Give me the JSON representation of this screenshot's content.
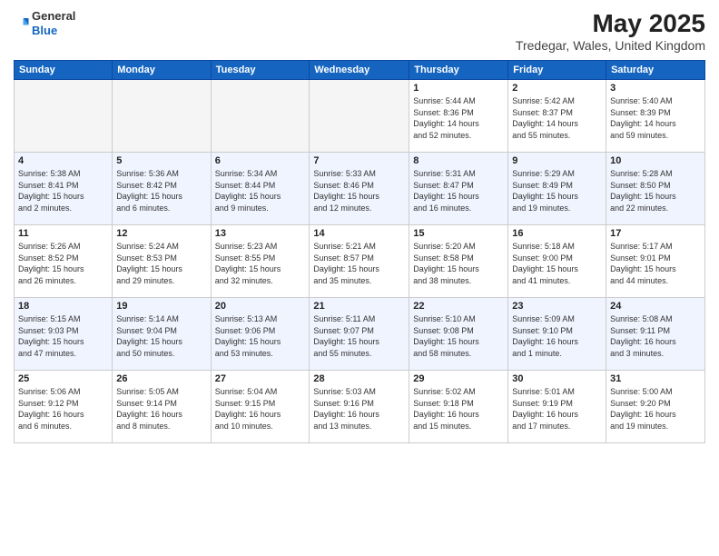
{
  "header": {
    "logo_line1": "General",
    "logo_line2": "Blue",
    "month": "May 2025",
    "location": "Tredegar, Wales, United Kingdom"
  },
  "days_of_week": [
    "Sunday",
    "Monday",
    "Tuesday",
    "Wednesday",
    "Thursday",
    "Friday",
    "Saturday"
  ],
  "weeks": [
    [
      {
        "day": "",
        "info": ""
      },
      {
        "day": "",
        "info": ""
      },
      {
        "day": "",
        "info": ""
      },
      {
        "day": "",
        "info": ""
      },
      {
        "day": "1",
        "info": "Sunrise: 5:44 AM\nSunset: 8:36 PM\nDaylight: 14 hours\nand 52 minutes."
      },
      {
        "day": "2",
        "info": "Sunrise: 5:42 AM\nSunset: 8:37 PM\nDaylight: 14 hours\nand 55 minutes."
      },
      {
        "day": "3",
        "info": "Sunrise: 5:40 AM\nSunset: 8:39 PM\nDaylight: 14 hours\nand 59 minutes."
      }
    ],
    [
      {
        "day": "4",
        "info": "Sunrise: 5:38 AM\nSunset: 8:41 PM\nDaylight: 15 hours\nand 2 minutes."
      },
      {
        "day": "5",
        "info": "Sunrise: 5:36 AM\nSunset: 8:42 PM\nDaylight: 15 hours\nand 6 minutes."
      },
      {
        "day": "6",
        "info": "Sunrise: 5:34 AM\nSunset: 8:44 PM\nDaylight: 15 hours\nand 9 minutes."
      },
      {
        "day": "7",
        "info": "Sunrise: 5:33 AM\nSunset: 8:46 PM\nDaylight: 15 hours\nand 12 minutes."
      },
      {
        "day": "8",
        "info": "Sunrise: 5:31 AM\nSunset: 8:47 PM\nDaylight: 15 hours\nand 16 minutes."
      },
      {
        "day": "9",
        "info": "Sunrise: 5:29 AM\nSunset: 8:49 PM\nDaylight: 15 hours\nand 19 minutes."
      },
      {
        "day": "10",
        "info": "Sunrise: 5:28 AM\nSunset: 8:50 PM\nDaylight: 15 hours\nand 22 minutes."
      }
    ],
    [
      {
        "day": "11",
        "info": "Sunrise: 5:26 AM\nSunset: 8:52 PM\nDaylight: 15 hours\nand 26 minutes."
      },
      {
        "day": "12",
        "info": "Sunrise: 5:24 AM\nSunset: 8:53 PM\nDaylight: 15 hours\nand 29 minutes."
      },
      {
        "day": "13",
        "info": "Sunrise: 5:23 AM\nSunset: 8:55 PM\nDaylight: 15 hours\nand 32 minutes."
      },
      {
        "day": "14",
        "info": "Sunrise: 5:21 AM\nSunset: 8:57 PM\nDaylight: 15 hours\nand 35 minutes."
      },
      {
        "day": "15",
        "info": "Sunrise: 5:20 AM\nSunset: 8:58 PM\nDaylight: 15 hours\nand 38 minutes."
      },
      {
        "day": "16",
        "info": "Sunrise: 5:18 AM\nSunset: 9:00 PM\nDaylight: 15 hours\nand 41 minutes."
      },
      {
        "day": "17",
        "info": "Sunrise: 5:17 AM\nSunset: 9:01 PM\nDaylight: 15 hours\nand 44 minutes."
      }
    ],
    [
      {
        "day": "18",
        "info": "Sunrise: 5:15 AM\nSunset: 9:03 PM\nDaylight: 15 hours\nand 47 minutes."
      },
      {
        "day": "19",
        "info": "Sunrise: 5:14 AM\nSunset: 9:04 PM\nDaylight: 15 hours\nand 50 minutes."
      },
      {
        "day": "20",
        "info": "Sunrise: 5:13 AM\nSunset: 9:06 PM\nDaylight: 15 hours\nand 53 minutes."
      },
      {
        "day": "21",
        "info": "Sunrise: 5:11 AM\nSunset: 9:07 PM\nDaylight: 15 hours\nand 55 minutes."
      },
      {
        "day": "22",
        "info": "Sunrise: 5:10 AM\nSunset: 9:08 PM\nDaylight: 15 hours\nand 58 minutes."
      },
      {
        "day": "23",
        "info": "Sunrise: 5:09 AM\nSunset: 9:10 PM\nDaylight: 16 hours\nand 1 minute."
      },
      {
        "day": "24",
        "info": "Sunrise: 5:08 AM\nSunset: 9:11 PM\nDaylight: 16 hours\nand 3 minutes."
      }
    ],
    [
      {
        "day": "25",
        "info": "Sunrise: 5:06 AM\nSunset: 9:12 PM\nDaylight: 16 hours\nand 6 minutes."
      },
      {
        "day": "26",
        "info": "Sunrise: 5:05 AM\nSunset: 9:14 PM\nDaylight: 16 hours\nand 8 minutes."
      },
      {
        "day": "27",
        "info": "Sunrise: 5:04 AM\nSunset: 9:15 PM\nDaylight: 16 hours\nand 10 minutes."
      },
      {
        "day": "28",
        "info": "Sunrise: 5:03 AM\nSunset: 9:16 PM\nDaylight: 16 hours\nand 13 minutes."
      },
      {
        "day": "29",
        "info": "Sunrise: 5:02 AM\nSunset: 9:18 PM\nDaylight: 16 hours\nand 15 minutes."
      },
      {
        "day": "30",
        "info": "Sunrise: 5:01 AM\nSunset: 9:19 PM\nDaylight: 16 hours\nand 17 minutes."
      },
      {
        "day": "31",
        "info": "Sunrise: 5:00 AM\nSunset: 9:20 PM\nDaylight: 16 hours\nand 19 minutes."
      }
    ]
  ]
}
